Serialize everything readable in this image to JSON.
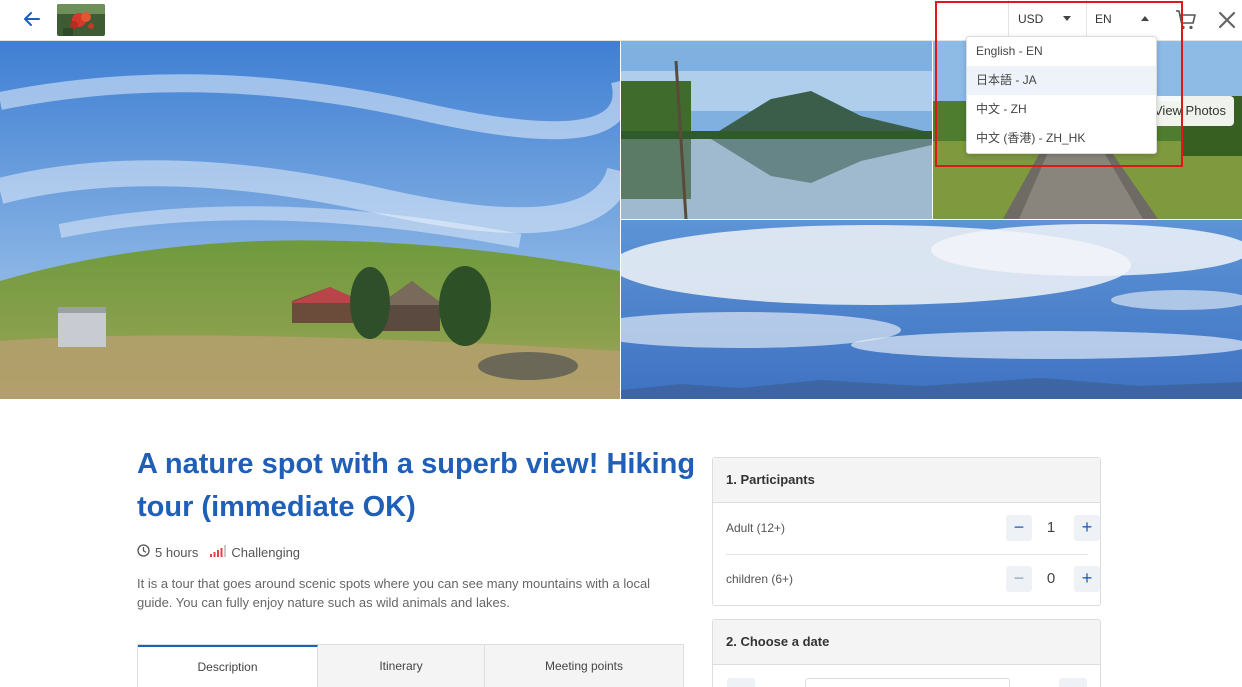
{
  "header": {
    "currency": {
      "selected": "USD"
    },
    "language": {
      "selected": "EN"
    },
    "language_options": [
      "English - EN",
      "日本語 - JA",
      "中文 - ZH",
      "中文 (香港) - ZH_HK"
    ]
  },
  "gallery": {
    "view_photos_label": "View Photos"
  },
  "tour": {
    "title": "A nature spot with a superb view! Hiking tour (immediate OK)",
    "duration": "5 hours",
    "difficulty": "Challenging",
    "description": "It is a tour that goes around scenic spots where you can see many mountains with a local guide. You can fully enjoy nature such as wild animals and lakes."
  },
  "tabs": [
    "Description",
    "Itinerary",
    "Meeting points"
  ],
  "booking": {
    "participants_heading": "1. Participants",
    "participants": [
      {
        "label": "Adult (12+)",
        "count": "1"
      },
      {
        "label": "children (6+)",
        "count": "0"
      }
    ],
    "minus_label": "−",
    "plus_label": "+",
    "date_heading": "2. Choose a date"
  },
  "colors": {
    "brand_blue": "#1f5fb7",
    "highlight_red": "#e0161b",
    "difficulty_red": "#e0454a"
  }
}
